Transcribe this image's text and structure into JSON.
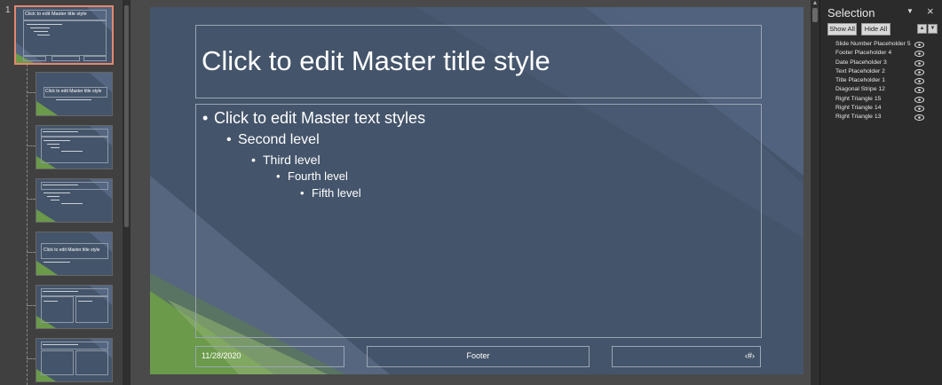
{
  "thumbnails": {
    "slide_number": "1",
    "master_title": "Click to edit Master title style",
    "layout_titles": [
      "Click to edit Master title style",
      "Click to edit Master title style"
    ]
  },
  "slide": {
    "title": "Click to edit Master title style",
    "body_levels": [
      "Click to edit Master text styles",
      "Second level",
      "Third level",
      "Fourth level",
      "Fifth level"
    ],
    "date": "11/28/2020",
    "footer": "Footer",
    "slide_number": "‹#›"
  },
  "selection_pane": {
    "title": "Selection",
    "dropdown_icon": "triangle-down",
    "close_icon": "close-x",
    "show_all_label": "Show All",
    "hide_all_label": "Hide All",
    "move_up_icon": "caret-up",
    "move_down_icon": "caret-down",
    "items": [
      {
        "label": "Slide Number Placeholder 5",
        "visible": true
      },
      {
        "label": "Footer Placeholder 4",
        "visible": true
      },
      {
        "label": "Date Placeholder 3",
        "visible": true
      },
      {
        "label": "Text Placeholder 2",
        "visible": true
      },
      {
        "label": "Title Placeholder 1",
        "visible": true
      },
      {
        "label": "Diagonal Stripe 12",
        "visible": true
      },
      {
        "label": "Right Triangle 15",
        "visible": true
      },
      {
        "label": "Right Triangle 14",
        "visible": true
      },
      {
        "label": "Right Triangle 13",
        "visible": true
      }
    ]
  },
  "colors": {
    "slide_background": "#44546a",
    "selected_thumbnail_outline": "#e4876d",
    "accent_green": "#6a9a4a",
    "accent_blue": "#5b6e8c"
  }
}
